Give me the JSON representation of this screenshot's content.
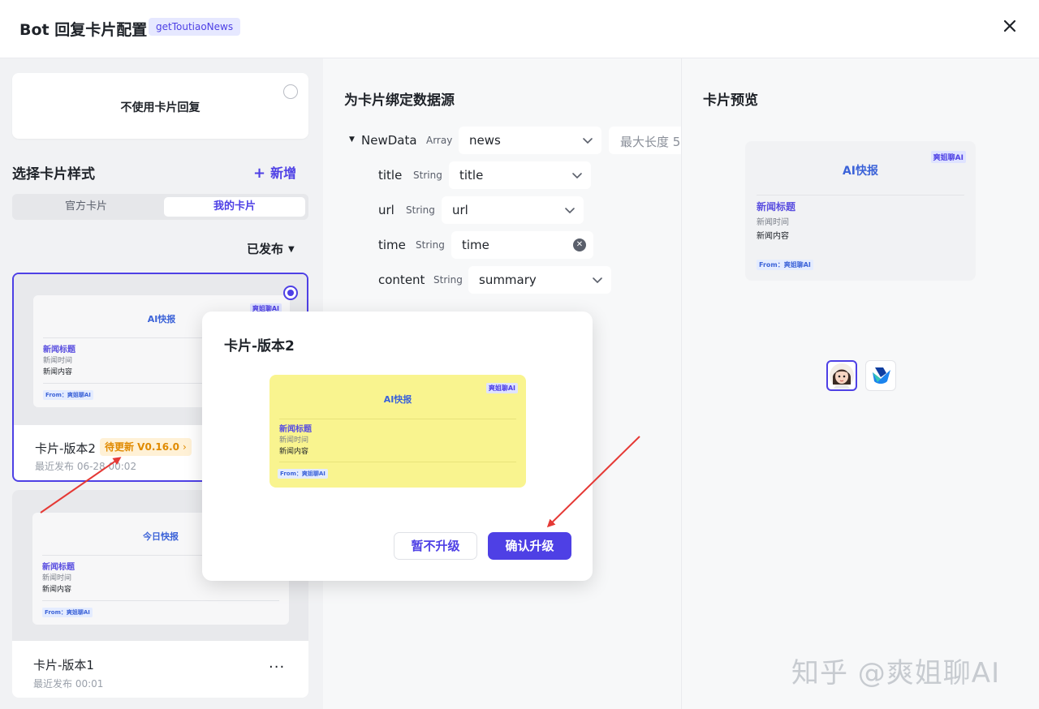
{
  "header": {
    "title": "Bot 回复卡片配置",
    "tag": "getToutiaoNews",
    "close_icon": "close-icon"
  },
  "left": {
    "no_card": {
      "label": "不使用卡片回复"
    },
    "section_title": "选择卡片样式",
    "add_label": "新增",
    "tabs": [
      {
        "label": "官方卡片",
        "active": false
      },
      {
        "label": "我的卡片",
        "active": true
      }
    ],
    "filter": "已发布",
    "cards": [
      {
        "name": "卡片-版本2",
        "badge": "待更新 V0.16.0",
        "published": "最近发布 06-28 00:02",
        "selected": true,
        "thumb": {
          "title": "AI快报",
          "brand": "爽姐聊AI",
          "news_title": "新闻标题",
          "news_time": "新闻时间",
          "news_content": "新闻内容",
          "from": "From：爽姐聊AI"
        }
      },
      {
        "name": "卡片-版本1",
        "published": "最近发布 00:01",
        "selected": false,
        "more": "···",
        "thumb": {
          "title": "今日快报",
          "news_title": "新闻标题",
          "news_time": "新闻时间",
          "news_content": "新闻内容",
          "from": "From：爽姐聊AI"
        }
      }
    ]
  },
  "middle": {
    "title": "为卡片绑定数据源",
    "root": {
      "name": "NewData",
      "type": "Array",
      "value": "news",
      "max_length_label": "最大长度 5"
    },
    "fields": [
      {
        "name": "title",
        "type": "String",
        "value": "title",
        "control": "select"
      },
      {
        "name": "url",
        "type": "String",
        "value": "url",
        "control": "select"
      },
      {
        "name": "time",
        "type": "String",
        "value": "time",
        "control": "clearable"
      },
      {
        "name": "content",
        "type": "String",
        "value": "summary",
        "control": "select"
      }
    ]
  },
  "right": {
    "title": "卡片预览",
    "preview": {
      "title": "AI快报",
      "brand": "爽姐聊AI",
      "news_title": "新闻标题",
      "news_time": "新闻时间",
      "news_content": "新闻内容",
      "from": "From：爽姐聊AI"
    },
    "avatars": [
      "female-avatar-icon",
      "feishu-logo-icon"
    ]
  },
  "modal": {
    "title": "卡片-版本2",
    "card": {
      "title": "AI快报",
      "brand": "爽姐聊AI",
      "news_title": "新闻标题",
      "news_time": "新闻时间",
      "news_content": "新闻内容",
      "from": "From：爽姐聊AI"
    },
    "cancel_label": "暂不升级",
    "confirm_label": "确认升级"
  },
  "watermark": "知乎 @爽姐聊AI",
  "colors": {
    "accent": "#4e40e5",
    "pending": "#e08a00",
    "card_yellow": "#f9f48f",
    "arrow": "#e53935"
  }
}
